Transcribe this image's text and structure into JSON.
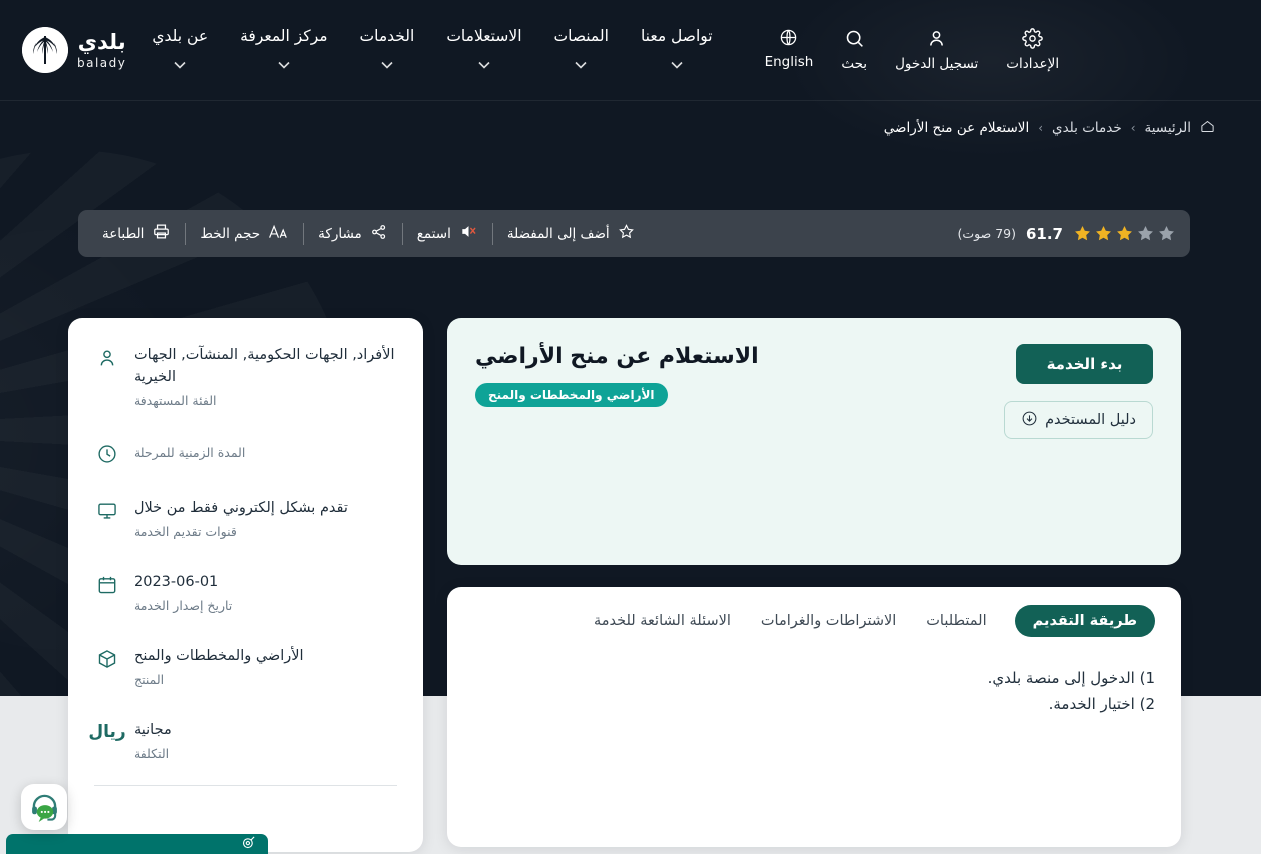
{
  "brand": {
    "arabic": "بلدي",
    "latin": "balady",
    "logo_icon": "palm-tree-circle-logo"
  },
  "nav": {
    "items": [
      {
        "label": "تواصل معنا",
        "icon": "chevron-down-icon"
      },
      {
        "label": "المنصات",
        "icon": "chevron-down-icon"
      },
      {
        "label": "الاستعلامات",
        "icon": "chevron-down-icon"
      },
      {
        "label": "الخدمات",
        "icon": "chevron-down-icon"
      },
      {
        "label": "مركز المعرفة",
        "icon": "chevron-down-icon"
      },
      {
        "label": "عن بلدي",
        "icon": "chevron-down-icon"
      }
    ],
    "utilities": [
      {
        "label": "الإعدادات",
        "icon": "gear-icon"
      },
      {
        "label": "تسجيل الدخول",
        "icon": "user-icon"
      },
      {
        "label": "بحث",
        "icon": "search-icon"
      },
      {
        "label": "English",
        "icon": "globe-icon"
      }
    ]
  },
  "breadcrumb": {
    "home_icon": "home-icon",
    "items": [
      "الرئيسية",
      "خدمات بلدي",
      "الاستعلام عن منح الأراضي"
    ],
    "separator": "›"
  },
  "toolbar": {
    "actions": [
      {
        "label": "الطباعة",
        "icon": "printer-icon"
      },
      {
        "label": "حجم الخط",
        "icon": "font-size-icon"
      },
      {
        "label": "مشاركة",
        "icon": "share-icon"
      },
      {
        "label": "استمع",
        "icon": "speaker-muted-icon"
      },
      {
        "label": "أضف إلى المفضلة",
        "icon": "star-outline-icon"
      }
    ],
    "rating": {
      "score": "61.7",
      "votes_label": "(79 صوت)",
      "stars_total": 5,
      "stars_filled": 3,
      "star_filled_color": "#f0b323",
      "star_empty_color": "#9aa2ab"
    }
  },
  "service": {
    "title": "الاستعلام عن منح الأراضي",
    "badge": "الأراضي والمخططات والمنح",
    "badge_color": "#0fa397",
    "primary_button": "بدء الخدمة",
    "primary_button_color": "#126156",
    "secondary_button": "دليل المستخدم",
    "secondary_button_icon": "download-circle-icon"
  },
  "tabs": {
    "items": [
      {
        "label": "طريقة التقديم",
        "active": true
      },
      {
        "label": "المتطلبات",
        "active": false
      },
      {
        "label": "الاشتراطات والغرامات",
        "active": false
      },
      {
        "label": "الاسئلة الشائعة للخدمة",
        "active": false
      }
    ],
    "steps": [
      "1) الدخول إلى منصة بلدي.",
      "2) اختيار الخدمة."
    ]
  },
  "info": {
    "rows": [
      {
        "icon": "user-icon",
        "value": "الأفراد, الجهات الحكومية, المنشآت, الجهات الخيرية",
        "label": "الفئة المستهدفة"
      },
      {
        "icon": "clock-icon",
        "value": "",
        "label": "المدة الزمنية للمرحلة"
      },
      {
        "icon": "monitor-icon",
        "value": "تقدم بشكل إلكتروني فقط من خلال",
        "label": "قنوات تقديم الخدمة"
      },
      {
        "icon": "calendar-icon",
        "value": "2023-06-01",
        "label": "تاريخ إصدار الخدمة"
      },
      {
        "icon": "box-icon",
        "value": "الأراضي والمخططات والمنح",
        "label": "المنتج"
      },
      {
        "icon": "riyal-icon",
        "value": "مجانية",
        "label": "التكلفة"
      }
    ]
  },
  "widgets": {
    "chat": {
      "icon": "headset-chat-icon",
      "label": ""
    },
    "bottom_bar": {
      "label": ""
    }
  }
}
